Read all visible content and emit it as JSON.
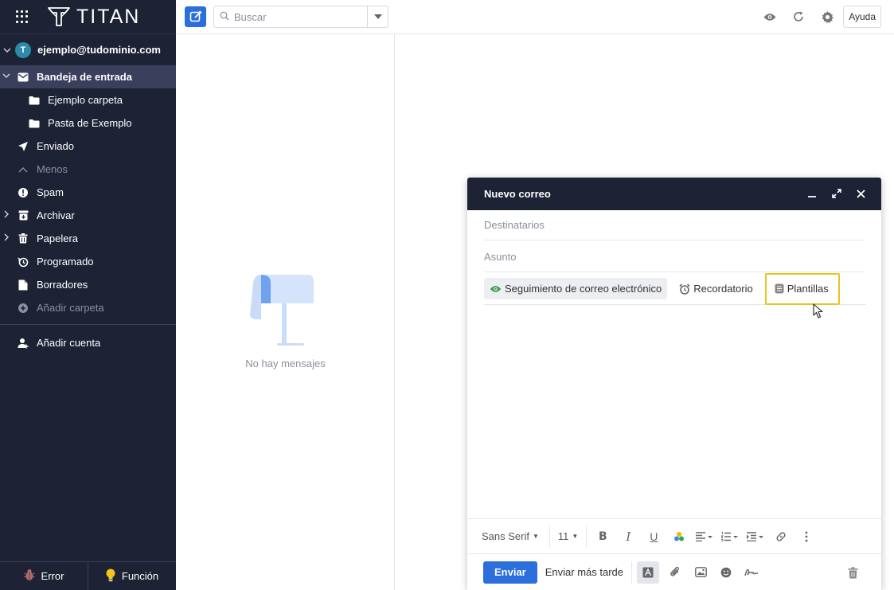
{
  "sidebar": {
    "brand": "TITAN",
    "account": {
      "avatar_letter": "T",
      "email": "ejemplo@tudominio.com"
    },
    "items": [
      {
        "label": "Bandeja de entrada"
      },
      {
        "label": "Ejemplo carpeta"
      },
      {
        "label": "Pasta de Exemplo"
      },
      {
        "label": "Enviado"
      },
      {
        "label": "Menos"
      },
      {
        "label": "Spam"
      },
      {
        "label": "Archivar"
      },
      {
        "label": "Papelera"
      },
      {
        "label": "Programado"
      },
      {
        "label": "Borradores"
      },
      {
        "label": "Añadir carpeta"
      }
    ],
    "add_account": "Añadir cuenta",
    "footer": {
      "error": "Error",
      "feature": "Función"
    }
  },
  "topbar": {
    "search_placeholder": "Buscar",
    "help": "Ayuda"
  },
  "message_list": {
    "empty_text": "No hay mensajes"
  },
  "compose": {
    "title": "Nuevo correo",
    "recipients_placeholder": "Destinatarios",
    "subject_placeholder": "Asunto",
    "options": {
      "tracking": "Seguimiento de correo electrónico",
      "reminder": "Recordatorio",
      "templates": "Plantillas"
    },
    "format": {
      "font": "Sans Serif",
      "size": "11"
    },
    "send": "Enviar",
    "send_later": "Enviar más tarde"
  },
  "colors": {
    "sidebar_bg": "#1d2235",
    "accent": "#2a6fdb",
    "highlight": "#e6c620",
    "tracking_eye": "#3fa34d"
  }
}
